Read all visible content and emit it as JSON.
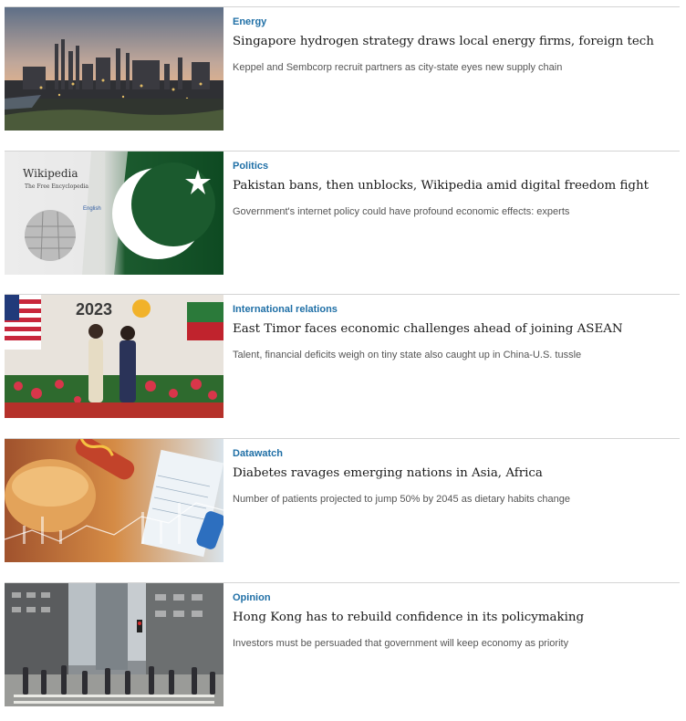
{
  "articles": [
    {
      "category": "Energy",
      "headline": "Singapore hydrogen strategy draws local energy firms, foreign tech",
      "summary": "Keppel and Sembcorp recruit partners as city-state eyes new supply chain",
      "image": "refinery-sunset-photo"
    },
    {
      "category": "Politics",
      "headline": "Pakistan bans, then unblocks, Wikipedia amid digital freedom fight",
      "summary": "Government's internet policy could have profound economic effects: experts",
      "image": "wikipedia-pakistan-flag-photo",
      "image_text": {
        "title": "Wikipedia",
        "tagline": "The Free Encyclopedia",
        "language": "English"
      }
    },
    {
      "category": "International relations",
      "headline": "East Timor faces economic challenges ahead of joining ASEAN",
      "summary": "Talent, financial deficits weigh on tiny state also caught up in China-U.S. tussle",
      "image": "asean-summit-photo",
      "image_text": {
        "year": "2023"
      }
    },
    {
      "category": "Datawatch",
      "headline": "Diabetes ravages emerging nations in Asia, Africa",
      "summary": "Number of patients projected to jump 50% by 2045 as dietary habits change",
      "image": "fast-food-glucose-meter-photo"
    },
    {
      "category": "Opinion",
      "headline": "Hong Kong has to rebuild confidence in its policymaking",
      "summary": "Investors must be persuaded that government will keep economy as priority",
      "image": "hong-kong-street-crossing-photo"
    }
  ],
  "colors": {
    "category": "#1f6fa6",
    "headline": "#1a1a1a",
    "summary": "#555555",
    "divider": "#d4d4d4"
  }
}
